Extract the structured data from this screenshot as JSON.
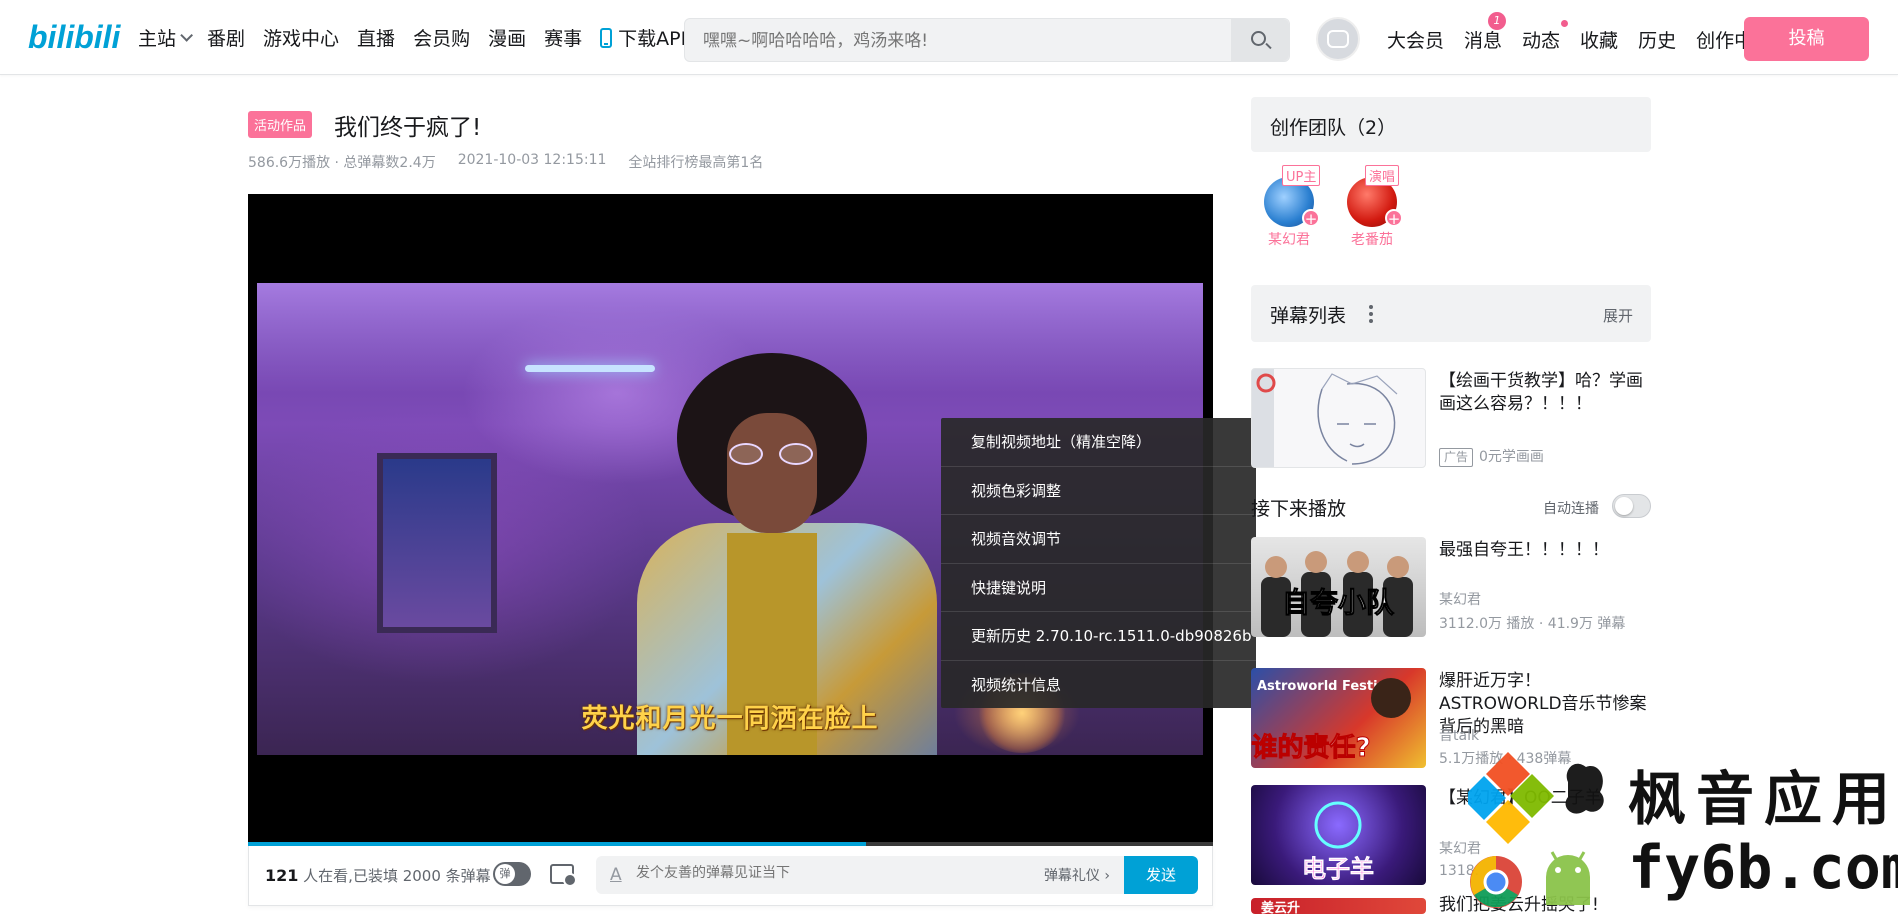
{
  "header": {
    "logo": "bilibili",
    "nav": [
      "主站",
      "番剧",
      "游戏中心",
      "直播",
      "会员购",
      "漫画",
      "赛事",
      "下载APP"
    ],
    "search_placeholder": "嘿嘿~啊哈哈哈哈，鸡汤来咯!",
    "right_nav": [
      "大会员",
      "消息",
      "动态",
      "收藏",
      "历史",
      "创作中心"
    ],
    "message_badge": "1",
    "upload_label": "投稿"
  },
  "video": {
    "tag": "活动作品",
    "title": "我们终于疯了!",
    "views": "586.6万播放 · 总弹幕数2.4万",
    "date": "2021-10-03 12:15:11",
    "rank": "全站排行榜最高第1名",
    "subtitle": "荧光和月光一同洒在脸上",
    "progress": 0.64
  },
  "context_menu": [
    "复制视频地址（精准空降）",
    "视频色彩调整",
    "视频音效调节",
    "快捷键说明",
    "更新历史 2.70.10-rc.1511.0-db90826b",
    "视频统计信息"
  ],
  "danmaku_bar": {
    "watching_count": "121",
    "watching_text": " 人在看,已装填 2000 条弹幕",
    "toggle_label": "弹",
    "input_icon": "A",
    "placeholder": "发个友善的弹幕见证当下",
    "etiquette": "弹幕礼仪 ›",
    "send": "发送"
  },
  "sidebar": {
    "team_title": "创作团队（2）",
    "members": [
      {
        "role": "UP主",
        "name": "某幻君"
      },
      {
        "role": "演唱",
        "name": "老番茄"
      }
    ],
    "danmaku_list_title": "弹幕列表",
    "expand": "展开",
    "ad": {
      "title": "【绘画干货教学】哈？学画画这么容易？！！！",
      "tag": "广告",
      "source": "0元学画画"
    },
    "next_title": "接下来播放",
    "autoplay": "自动连播",
    "videos": [
      {
        "title": "最强自夸王！！！！！",
        "up": "某幻君",
        "stats": "3112.0万 播放 · 41.9万 弹幕",
        "thumb_text": "自夸小队"
      },
      {
        "title": "爆肝近万字！ASTROWORLD音乐节惨案背后的黑暗",
        "up": "音talk",
        "stats": "5.1万播放 · 438弹幕",
        "thumb_text": "谁的责任?",
        "thumb_sub": "Astroworld Festival"
      },
      {
        "title": "【某幻君】OO二子羊",
        "up": "某幻君",
        "stats": "1318.",
        "thumb_text": "电子羊"
      },
      {
        "title": "我们把姜云升摇哭了!",
        "up": "",
        "stats": "",
        "thumb_text": "姜云升"
      }
    ]
  },
  "watermark": {
    "line1": "枫音应用",
    "line2": "fy6b.com"
  }
}
